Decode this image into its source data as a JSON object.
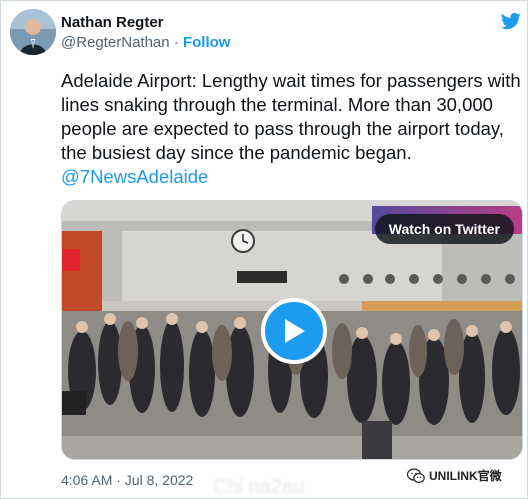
{
  "author": {
    "name": "Nathan Regter",
    "handle": "@RegterNathan",
    "separator": "·",
    "follow_label": "Follow"
  },
  "icons": {
    "brand": "twitter-bird-icon",
    "play": "play-icon"
  },
  "tweet": {
    "text": "Adelaide Airport: Lengthy wait times for passengers with lines snaking through the terminal. More than 30,000 people are expected to pass through the airport today, the busiest day since the pandemic began.",
    "mention": "@7NewsAdelaide"
  },
  "media": {
    "watch_label": "Watch on Twitter"
  },
  "timestamp": "4:06 AM · Jul 8, 2022",
  "watermarks": {
    "bottom": "Chi na2au",
    "right": "UNILINK官微"
  },
  "colors": {
    "accent": "#1d9bf0",
    "text": "#0f1419",
    "muted": "#536471",
    "border": "#cfd9de"
  }
}
